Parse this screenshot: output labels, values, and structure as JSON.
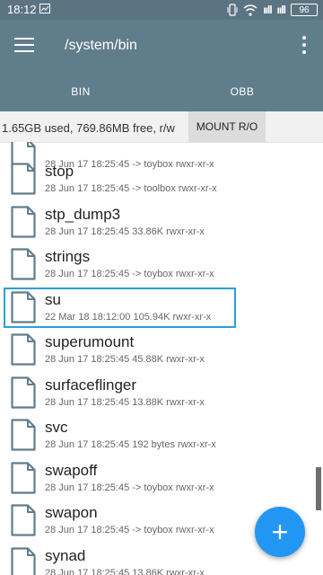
{
  "status_bar": {
    "time": "18:12",
    "signal_label_1": "ııll",
    "signal_label_2": "ııll",
    "battery": "96"
  },
  "app_bar": {
    "title": "/system/bin"
  },
  "tabs": [
    {
      "label": "BIN",
      "active": true
    },
    {
      "label": "OBB",
      "active": false
    }
  ],
  "storage": {
    "info": "1.65GB used, 769.86MB free, r/w",
    "mount_label": "MOUNT R/O"
  },
  "files": [
    {
      "name": "",
      "meta": "28 Jun 17 18:25:45  -> toybox  rwxr-xr-x"
    },
    {
      "name": "stop",
      "meta": "28 Jun 17 18:25:45  -> toolbox  rwxr-xr-x"
    },
    {
      "name": "stp_dump3",
      "meta": "28 Jun 17 18:25:45  33.86K  rwxr-xr-x"
    },
    {
      "name": "strings",
      "meta": "28 Jun 17 18:25:45  -> toybox  rwxr-xr-x"
    },
    {
      "name": "su",
      "meta": "22 Mar 18 18:12:00  105.94K  rwxr-xr-x"
    },
    {
      "name": "superumount",
      "meta": "28 Jun 17 18:25:45  45.88K  rwxr-xr-x"
    },
    {
      "name": "surfaceflinger",
      "meta": "28 Jun 17 18:25:45  13.88K  rwxr-xr-x"
    },
    {
      "name": "svc",
      "meta": "28 Jun 17 18:25:45  192 bytes  rwxr-xr-x"
    },
    {
      "name": "swapoff",
      "meta": "28 Jun 17 18:25:45  -> toybox  rwxr-xr-x"
    },
    {
      "name": "swapon",
      "meta": "28 Jun 17 18:25:45  -> toybox  rwxr-xr-x"
    },
    {
      "name": "synad",
      "meta": "28 Jun 17 18:25:45  13.86K  rwxr-xr-x"
    }
  ],
  "fab": {
    "label": "+"
  },
  "colors": {
    "app_bar": "#607d8b",
    "accent": "#2196f3",
    "selection": "#2a9fd6"
  }
}
